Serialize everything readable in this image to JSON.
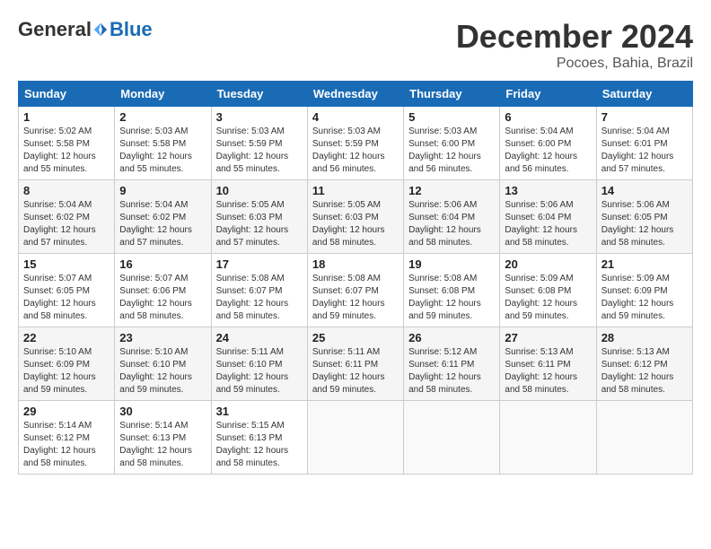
{
  "header": {
    "logo": {
      "general": "General",
      "blue": "Blue"
    },
    "title": "December 2024",
    "location": "Pocoes, Bahia, Brazil"
  },
  "calendar": {
    "days_of_week": [
      "Sunday",
      "Monday",
      "Tuesday",
      "Wednesday",
      "Thursday",
      "Friday",
      "Saturday"
    ],
    "weeks": [
      [
        null,
        {
          "day": "2",
          "sunrise": "Sunrise: 5:03 AM",
          "sunset": "Sunset: 5:58 PM",
          "daylight": "Daylight: 12 hours and 55 minutes."
        },
        {
          "day": "3",
          "sunrise": "Sunrise: 5:03 AM",
          "sunset": "Sunset: 5:59 PM",
          "daylight": "Daylight: 12 hours and 55 minutes."
        },
        {
          "day": "4",
          "sunrise": "Sunrise: 5:03 AM",
          "sunset": "Sunset: 5:59 PM",
          "daylight": "Daylight: 12 hours and 56 minutes."
        },
        {
          "day": "5",
          "sunrise": "Sunrise: 5:03 AM",
          "sunset": "Sunset: 6:00 PM",
          "daylight": "Daylight: 12 hours and 56 minutes."
        },
        {
          "day": "6",
          "sunrise": "Sunrise: 5:04 AM",
          "sunset": "Sunset: 6:00 PM",
          "daylight": "Daylight: 12 hours and 56 minutes."
        },
        {
          "day": "7",
          "sunrise": "Sunrise: 5:04 AM",
          "sunset": "Sunset: 6:01 PM",
          "daylight": "Daylight: 12 hours and 57 minutes."
        }
      ],
      [
        {
          "day": "1",
          "sunrise": "Sunrise: 5:02 AM",
          "sunset": "Sunset: 5:58 PM",
          "daylight": "Daylight: 12 hours and 55 minutes."
        },
        {
          "day": "9",
          "sunrise": "Sunrise: 5:04 AM",
          "sunset": "Sunset: 6:02 PM",
          "daylight": "Daylight: 12 hours and 57 minutes."
        },
        {
          "day": "10",
          "sunrise": "Sunrise: 5:05 AM",
          "sunset": "Sunset: 6:03 PM",
          "daylight": "Daylight: 12 hours and 57 minutes."
        },
        {
          "day": "11",
          "sunrise": "Sunrise: 5:05 AM",
          "sunset": "Sunset: 6:03 PM",
          "daylight": "Daylight: 12 hours and 58 minutes."
        },
        {
          "day": "12",
          "sunrise": "Sunrise: 5:06 AM",
          "sunset": "Sunset: 6:04 PM",
          "daylight": "Daylight: 12 hours and 58 minutes."
        },
        {
          "day": "13",
          "sunrise": "Sunrise: 5:06 AM",
          "sunset": "Sunset: 6:04 PM",
          "daylight": "Daylight: 12 hours and 58 minutes."
        },
        {
          "day": "14",
          "sunrise": "Sunrise: 5:06 AM",
          "sunset": "Sunset: 6:05 PM",
          "daylight": "Daylight: 12 hours and 58 minutes."
        }
      ],
      [
        {
          "day": "8",
          "sunrise": "Sunrise: 5:04 AM",
          "sunset": "Sunset: 6:02 PM",
          "daylight": "Daylight: 12 hours and 57 minutes."
        },
        {
          "day": "16",
          "sunrise": "Sunrise: 5:07 AM",
          "sunset": "Sunset: 6:06 PM",
          "daylight": "Daylight: 12 hours and 58 minutes."
        },
        {
          "day": "17",
          "sunrise": "Sunrise: 5:08 AM",
          "sunset": "Sunset: 6:07 PM",
          "daylight": "Daylight: 12 hours and 58 minutes."
        },
        {
          "day": "18",
          "sunrise": "Sunrise: 5:08 AM",
          "sunset": "Sunset: 6:07 PM",
          "daylight": "Daylight: 12 hours and 59 minutes."
        },
        {
          "day": "19",
          "sunrise": "Sunrise: 5:08 AM",
          "sunset": "Sunset: 6:08 PM",
          "daylight": "Daylight: 12 hours and 59 minutes."
        },
        {
          "day": "20",
          "sunrise": "Sunrise: 5:09 AM",
          "sunset": "Sunset: 6:08 PM",
          "daylight": "Daylight: 12 hours and 59 minutes."
        },
        {
          "day": "21",
          "sunrise": "Sunrise: 5:09 AM",
          "sunset": "Sunset: 6:09 PM",
          "daylight": "Daylight: 12 hours and 59 minutes."
        }
      ],
      [
        {
          "day": "15",
          "sunrise": "Sunrise: 5:07 AM",
          "sunset": "Sunset: 6:05 PM",
          "daylight": "Daylight: 12 hours and 58 minutes."
        },
        {
          "day": "23",
          "sunrise": "Sunrise: 5:10 AM",
          "sunset": "Sunset: 6:10 PM",
          "daylight": "Daylight: 12 hours and 59 minutes."
        },
        {
          "day": "24",
          "sunrise": "Sunrise: 5:11 AM",
          "sunset": "Sunset: 6:10 PM",
          "daylight": "Daylight: 12 hours and 59 minutes."
        },
        {
          "day": "25",
          "sunrise": "Sunrise: 5:11 AM",
          "sunset": "Sunset: 6:11 PM",
          "daylight": "Daylight: 12 hours and 59 minutes."
        },
        {
          "day": "26",
          "sunrise": "Sunrise: 5:12 AM",
          "sunset": "Sunset: 6:11 PM",
          "daylight": "Daylight: 12 hours and 58 minutes."
        },
        {
          "day": "27",
          "sunrise": "Sunrise: 5:13 AM",
          "sunset": "Sunset: 6:11 PM",
          "daylight": "Daylight: 12 hours and 58 minutes."
        },
        {
          "day": "28",
          "sunrise": "Sunrise: 5:13 AM",
          "sunset": "Sunset: 6:12 PM",
          "daylight": "Daylight: 12 hours and 58 minutes."
        }
      ],
      [
        {
          "day": "22",
          "sunrise": "Sunrise: 5:10 AM",
          "sunset": "Sunset: 6:09 PM",
          "daylight": "Daylight: 12 hours and 59 minutes."
        },
        {
          "day": "30",
          "sunrise": "Sunrise: 5:14 AM",
          "sunset": "Sunset: 6:13 PM",
          "daylight": "Daylight: 12 hours and 58 minutes."
        },
        {
          "day": "31",
          "sunrise": "Sunrise: 5:15 AM",
          "sunset": "Sunset: 6:13 PM",
          "daylight": "Daylight: 12 hours and 58 minutes."
        },
        null,
        null,
        null,
        null
      ],
      [
        {
          "day": "29",
          "sunrise": "Sunrise: 5:14 AM",
          "sunset": "Sunset: 6:12 PM",
          "daylight": "Daylight: 12 hours and 58 minutes."
        },
        null,
        null,
        null,
        null,
        null,
        null
      ]
    ]
  }
}
